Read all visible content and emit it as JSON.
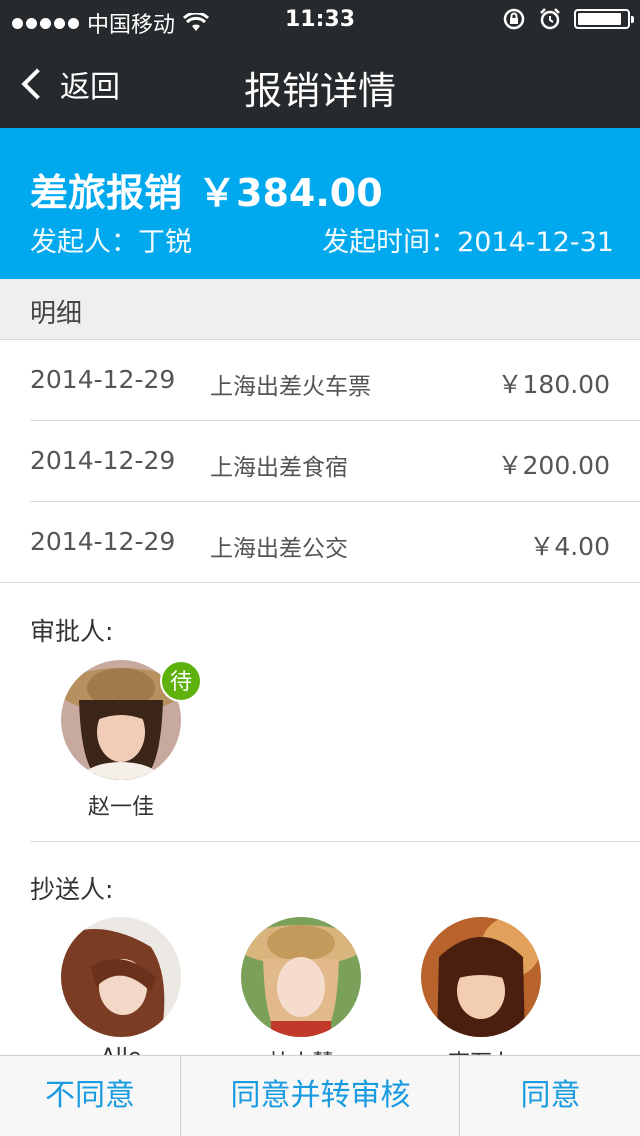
{
  "status_bar": {
    "carrier": "中国移动",
    "time": "11:33",
    "battery_level": 0.9,
    "icons": [
      "signal-dots-icon",
      "wifi-icon",
      "rotation-lock-icon",
      "alarm-icon",
      "battery-icon"
    ]
  },
  "nav": {
    "back_label": "返回",
    "title": "报销详情"
  },
  "summary": {
    "title": "差旅报销",
    "amount": "￥384.00",
    "initiator_label": "发起人：",
    "initiator": "丁锐",
    "time_label": "发起时间：",
    "time": "2014-12-31",
    "background_color": "#00a8ee"
  },
  "details": {
    "header": "明细",
    "rows": [
      {
        "date": "2014-12-29",
        "desc": "上海出差火车票",
        "amount": "￥180.00"
      },
      {
        "date": "2014-12-29",
        "desc": "上海出差食宿",
        "amount": "￥200.00"
      },
      {
        "date": "2014-12-29",
        "desc": "上海出差公交",
        "amount": "￥4.00"
      }
    ]
  },
  "approvers": {
    "label": "审批人:",
    "people": [
      {
        "name": "赵一佳",
        "badge": "待"
      }
    ]
  },
  "cc": {
    "label": "抄送人:",
    "people": [
      {
        "name": "Alle"
      },
      {
        "name": "杜小慧"
      },
      {
        "name": "李石卜"
      }
    ]
  },
  "actions": {
    "reject": "不同意",
    "approve_forward": "同意并转审核",
    "approve": "同意",
    "accent_color": "#1a9be0"
  }
}
